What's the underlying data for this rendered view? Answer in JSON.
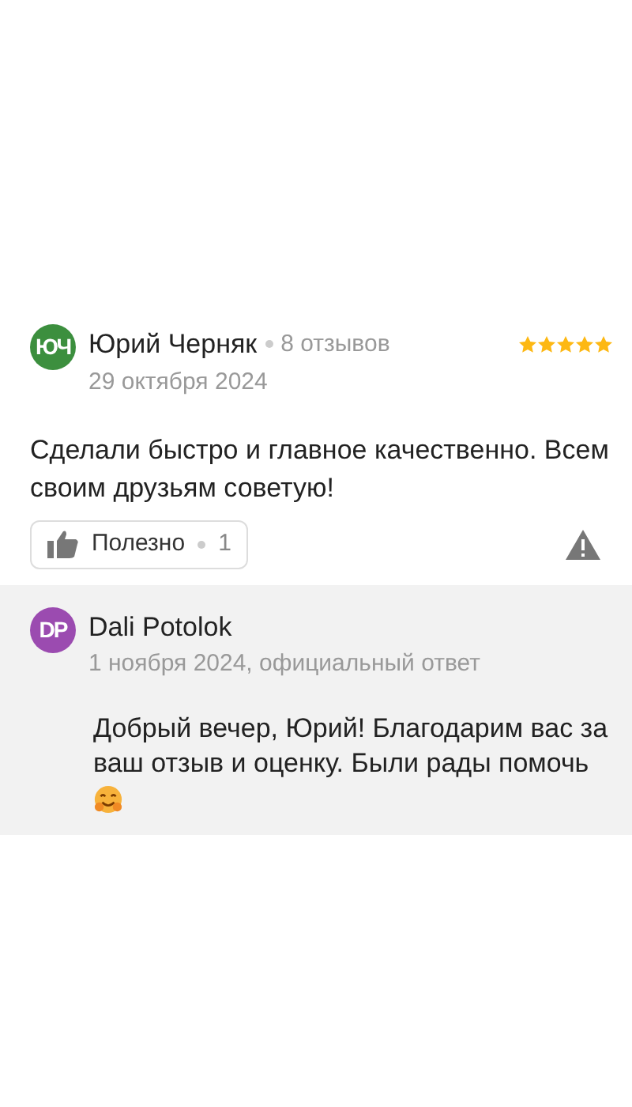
{
  "review": {
    "avatar": "ЮЧ",
    "author": "Юрий Черняк",
    "reviews_count": "8 отзывов",
    "date": "29 октября 2024",
    "stars": 5,
    "text": "Сделали быстро и главное качественно. Всем своим друзьям советую!",
    "useful": {
      "label": "Полезно",
      "count": "1"
    }
  },
  "reply": {
    "avatar": "DP",
    "author": "Dali Potolok",
    "meta": "1 ноября 2024, официальный ответ",
    "text": "Добрый вечер, Юрий! Благодарим вас за ваш отзыв и оценку. Были рады помочь"
  }
}
